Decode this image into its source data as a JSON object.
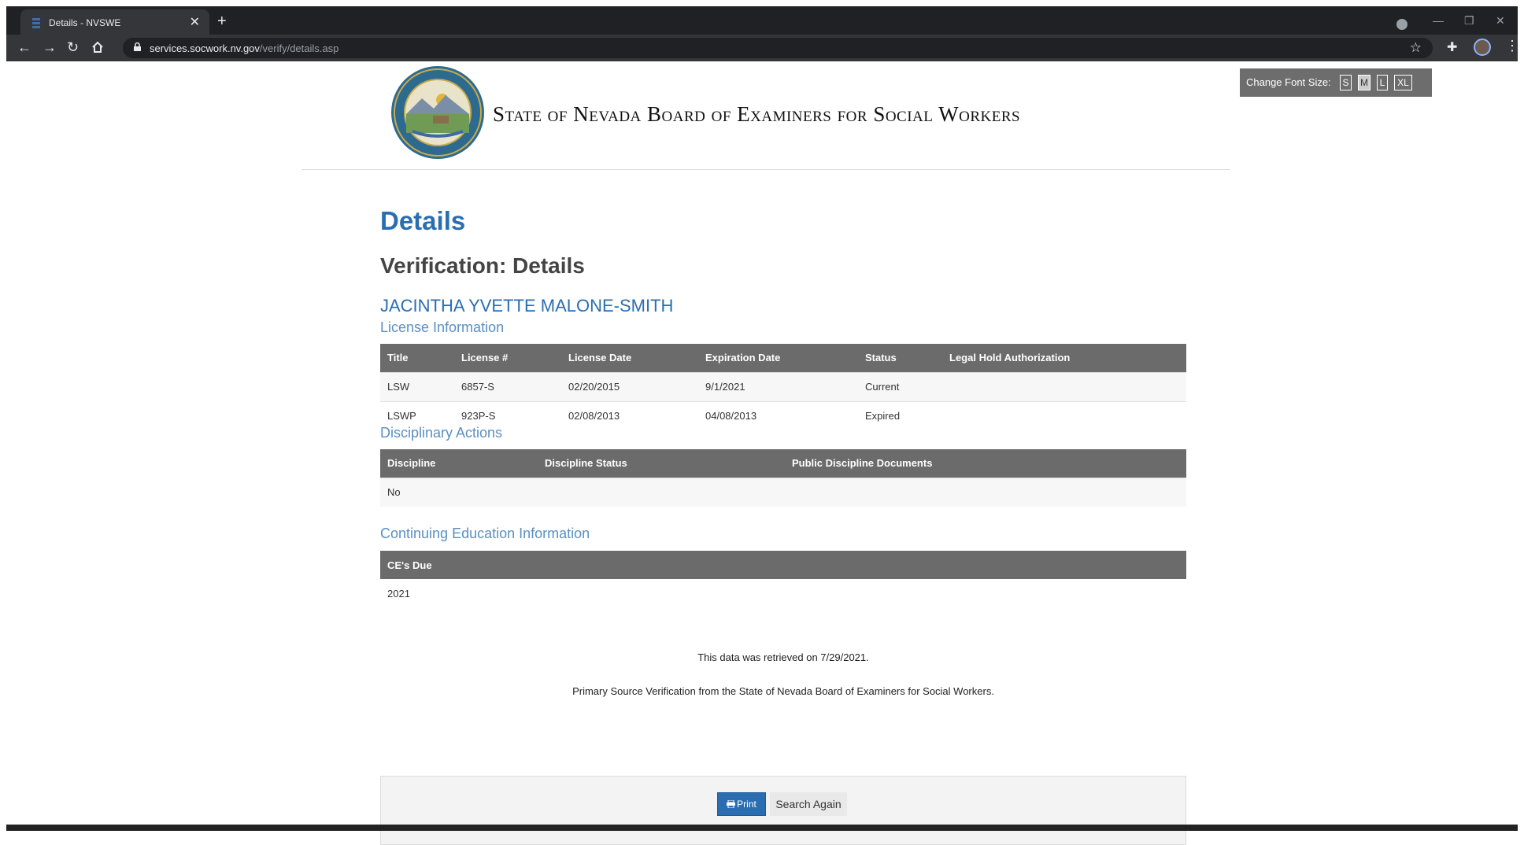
{
  "browser": {
    "tab_title": "Details - NVSWE",
    "tab_close": "✕",
    "new_tab": "+",
    "url_host": "services.socwork.nv.gov",
    "url_path": "/verify/details.asp",
    "icons": [
      "back-arrow-icon",
      "forward-arrow-icon",
      "reload-icon",
      "home-icon",
      "lock-icon",
      "star-icon",
      "extensions-icon",
      "profile-avatar",
      "menu-icon"
    ]
  },
  "header": {
    "site_title": "State of Nevada Board of Examiners for Social Workers",
    "font_size_label": "Change Font Size:",
    "font_sizes": [
      "S",
      "M",
      "L",
      "XL"
    ],
    "active_font_size": "M"
  },
  "main": {
    "title": "Details",
    "subtitle": "Verification: Details",
    "person_name": "JACINTHA YVETTE MALONE-SMITH",
    "license_heading": "License Information",
    "license_columns": [
      "Title",
      "License #",
      "License Date",
      "Expiration Date",
      "Status",
      "Legal Hold Authorization"
    ],
    "licenses": [
      {
        "title": "LSW",
        "license_no": "6857-S",
        "license_date": "02/20/2015",
        "expiration_date": "9/1/2021",
        "status": "Current",
        "legal_hold": ""
      },
      {
        "title": "LSWP",
        "license_no": "923P-S",
        "license_date": "02/08/2013",
        "expiration_date": "04/08/2013",
        "status": "Expired",
        "legal_hold": ""
      }
    ],
    "discipline_heading": "Disciplinary Actions",
    "discipline_columns": [
      "Discipline",
      "Discipline Status",
      "Public Discipline Documents"
    ],
    "discipline_rows": [
      {
        "discipline": "No",
        "status": "",
        "documents": ""
      }
    ],
    "ce_heading": "Continuing Education Information",
    "ce_columns": [
      "CE's Due"
    ],
    "ce_rows": [
      {
        "due": "2021"
      }
    ],
    "retrieved_note": "This data was retrieved on 7/29/2021.",
    "psv_note": "Primary Source Verification from the State of Nevada Board of Examiners for Social Workers.",
    "print_label": "Print",
    "search_again_label": "Search Again"
  },
  "colors": {
    "heading_blue": "#2a6eb1",
    "subheading_blue": "#5b8fc0",
    "table_header": "#6b6b6b"
  }
}
